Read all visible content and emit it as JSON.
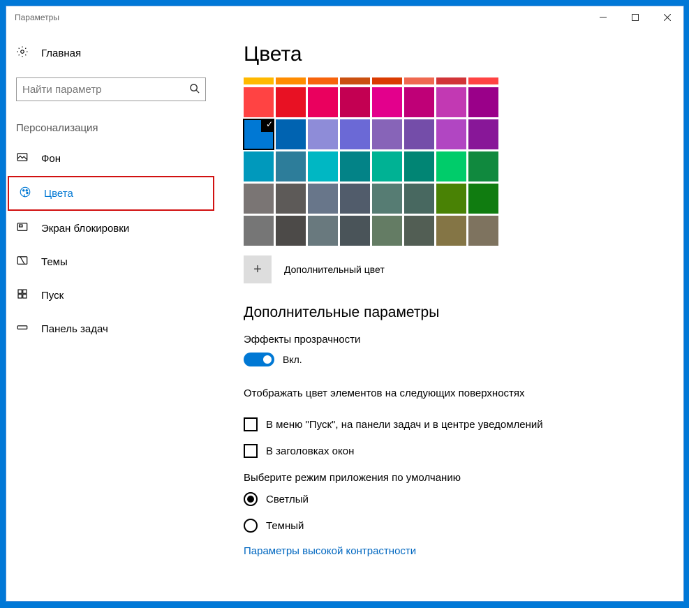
{
  "window": {
    "title": "Параметры"
  },
  "left": {
    "home": "Главная",
    "search_placeholder": "Найти параметр",
    "section": "Персонализация",
    "nav": [
      {
        "id": "background",
        "label": "Фон",
        "active": false
      },
      {
        "id": "colors",
        "label": "Цвета",
        "active": true
      },
      {
        "id": "lockscreen",
        "label": "Экран блокировки",
        "active": false
      },
      {
        "id": "themes",
        "label": "Темы",
        "active": false
      },
      {
        "id": "start",
        "label": "Пуск",
        "active": false
      },
      {
        "id": "taskbar",
        "label": "Панель задач",
        "active": false
      }
    ]
  },
  "main": {
    "title": "Цвета",
    "custom_color_label": "Дополнительный цвет",
    "subheader": "Дополнительные параметры",
    "transparency_label": "Эффекты прозрачности",
    "toggle_state": "Вкл.",
    "surfaces_label": "Отображать цвет элементов на следующих поверхностях",
    "checkboxes": [
      "В меню \"Пуск\", на панели задач и в центре уведомлений",
      "В заголовках окон"
    ],
    "app_mode_label": "Выберите режим приложения по умолчанию",
    "radios": [
      {
        "label": "Светлый",
        "checked": true
      },
      {
        "label": "Темный",
        "checked": false
      }
    ],
    "high_contrast_link": "Параметры высокой контрастности",
    "selected_color_index": 16,
    "colors_top_row": [
      "#ffb900",
      "#ff8c00",
      "#f7630c",
      "#ca5010",
      "#da3b01",
      "#ef6950",
      "#d13438",
      "#ff4343"
    ],
    "colors": [
      "#ff4343",
      "#e81123",
      "#ea005e",
      "#c30052",
      "#e3008c",
      "#bf0077",
      "#c239b3",
      "#9a0089",
      "#0078d4",
      "#0063b1",
      "#8e8cd8",
      "#6b69d6",
      "#8764b8",
      "#744da9",
      "#b146c2",
      "#881798",
      "#0099bc",
      "#2d7d9a",
      "#00b7c3",
      "#038387",
      "#00b294",
      "#018574",
      "#00cc6a",
      "#10893e",
      "#7a7574",
      "#5d5a58",
      "#68768a",
      "#515c6b",
      "#567c73",
      "#486860",
      "#498205",
      "#107c10",
      "#767676",
      "#4c4a48",
      "#69797e",
      "#4a5459",
      "#647c64",
      "#525e54",
      "#847545",
      "#7e735f"
    ]
  }
}
